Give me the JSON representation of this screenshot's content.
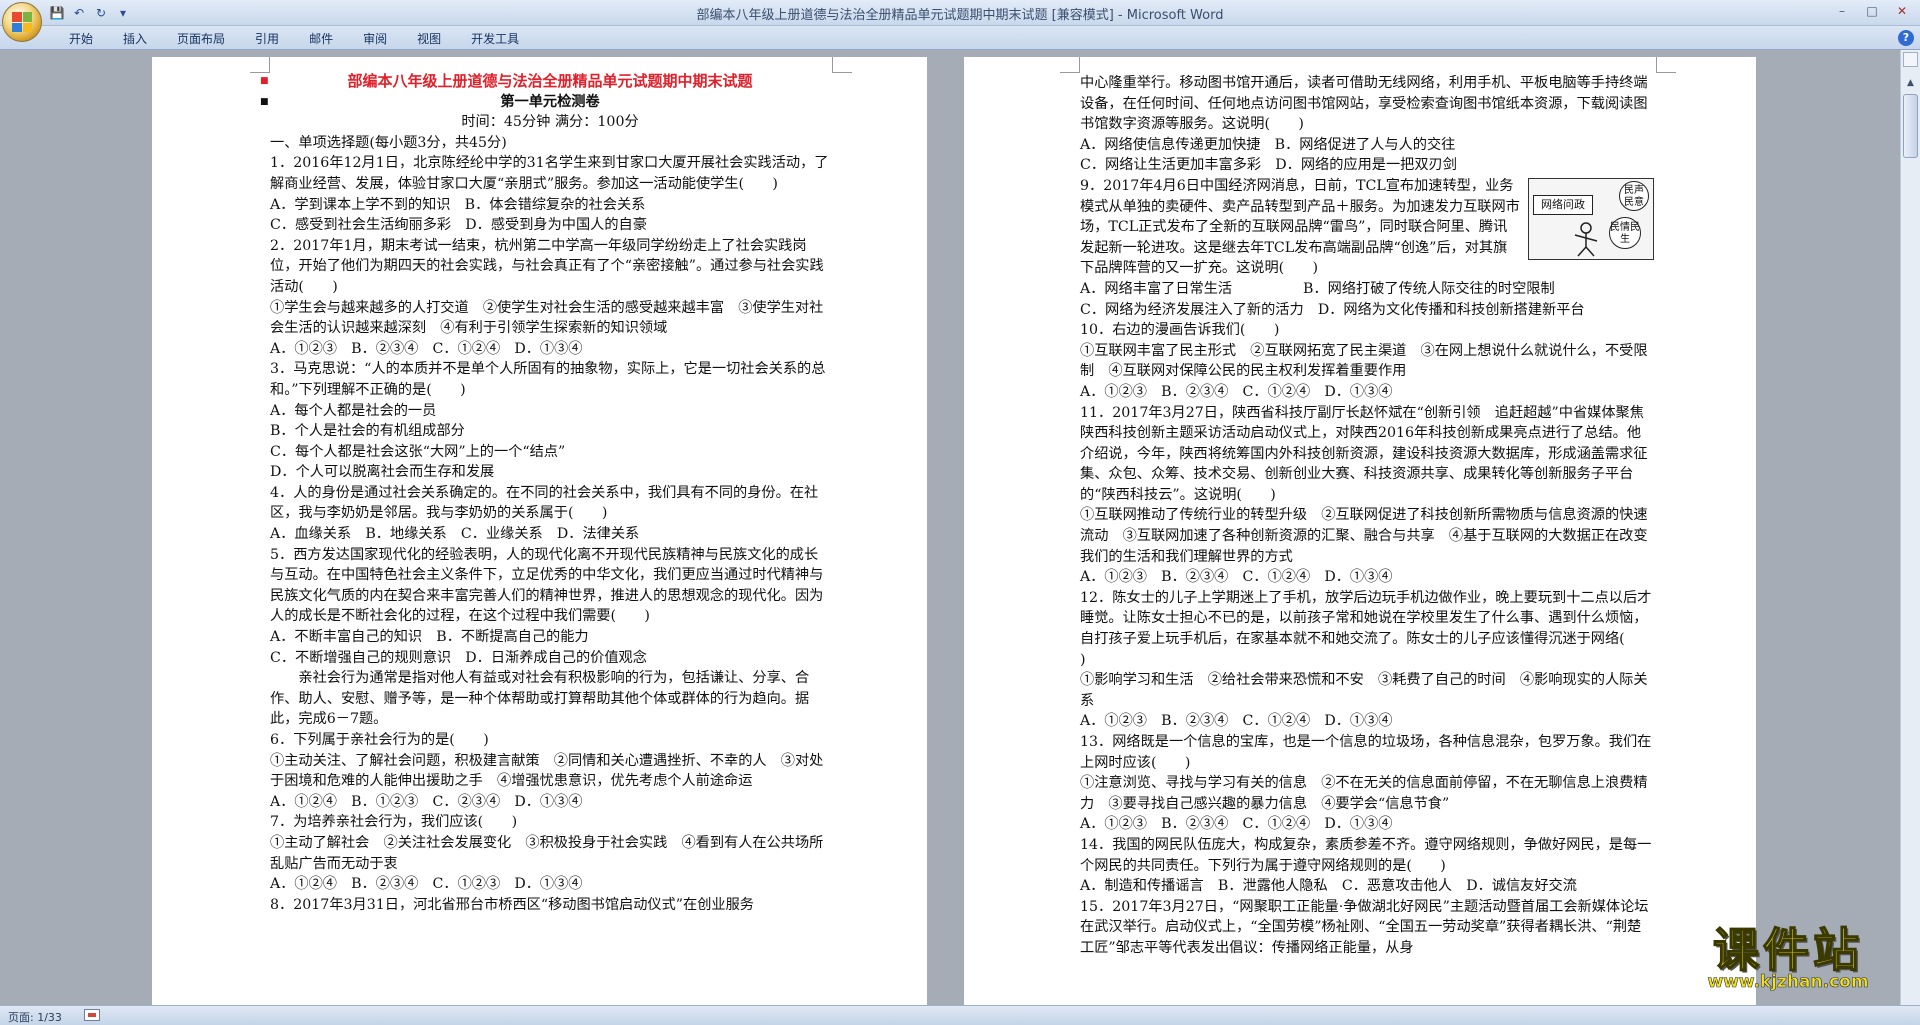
{
  "window": {
    "title": "部编本八年级上册道德与法治全册精品单元试题期中期末试题 [兼容模式] - Microsoft Word"
  },
  "ribbon": {
    "tabs": [
      "开始",
      "插入",
      "页面布局",
      "引用",
      "邮件",
      "审阅",
      "视图",
      "开发工具"
    ]
  },
  "statusbar": {
    "page": "页面: 1/33"
  },
  "watermark": {
    "brand": "课件站",
    "url": "www.kjzhan.com"
  },
  "icons": {
    "office_button": "office-button-icon",
    "save": "save-icon",
    "undo": "undo-icon",
    "redo": "redo-icon",
    "help": "help-icon"
  },
  "colors": {
    "doc_title": "#e0202a",
    "watermark": "#f2e21a",
    "page_bg": "#a5acb5"
  },
  "left_page": {
    "doc_title": "部编本八年级上册道德与法治全册精品单元试题期中期末试题",
    "unit_title": "第一单元检测卷",
    "time_info": "时间：45分钟      满分：100分",
    "lines": [
      "一、单项选择题(每小题3分，共45分)",
      "1．2016年12月1日，北京陈经纶中学的31名学生来到甘家口大厦开展社会实践活动，了解商业经营、发展，体验甘家口大厦“亲朋式”服务。参加这一活动能使学生(　　)",
      "A．学到课本上学不到的知识　B．体会错综复杂的社会关系",
      "C．感受到社会生活绚丽多彩　D．感受到身为中国人的自豪",
      "2．2017年1月，期末考试一结束，杭州第二中学高一年级同学纷纷走上了社会实践岗位，开始了他们为期四天的社会实践，与社会真正有了个“亲密接触”。通过参与社会实践活动(　　)",
      "①学生会与越来越多的人打交道　②使学生对社会生活的感受越来越丰富　③使学生对社会生活的认识越来越深刻　④有利于引领学生探索新的知识领域",
      "A．①②③　B．②③④　C．①②④　D．①③④",
      "3．马克思说：“人的本质并不是单个人所固有的抽象物，实际上，它是一切社会关系的总和。”下列理解不正确的是(　　)",
      "A．每个人都是社会的一员",
      "B．个人是社会的有机组成部分",
      "C．每个人都是社会这张“大网”上的一个“结点”",
      "D．个人可以脱离社会而生存和发展",
      "4．人的身份是通过社会关系确定的。在不同的社会关系中，我们具有不同的身份。在社区，我与李奶奶是邻居。我与李奶奶的关系属于(　　)",
      "A．血缘关系　B．地缘关系　C．业缘关系　D．法律关系",
      "5．西方发达国家现代化的经验表明，人的现代化离不开现代民族精神与民族文化的成长与互动。在中国特色社会主义条件下，立足优秀的中华文化，我们更应当通过时代精神与民族文化气质的内在契合来丰富完善人们的精神世界，推进人的思想观念的现代化。因为人的成长是不断社会化的过程，在这个过程中我们需要(　　)",
      "A．不断丰富自己的知识　B．不断提高自己的能力",
      "C．不断增强自己的规则意识　D．日渐养成自己的价值观念",
      "亲社会行为通常是指对他人有益或对社会有积极影响的行为，包括谦让、分享、合作、助人、安慰、赠予等，是一种个体帮助或打算帮助其他个体或群体的行为趋向。据此，完成6－7题。",
      "6．下列属于亲社会行为的是(　　)",
      "①主动关注、了解社会问题，积极建言献策　②同情和关心遭遇挫折、不幸的人　③对处于困境和危难的人能伸出援助之手　④增强忧患意识，优先考虑个人前途命运",
      "A．①②④　B．①②③　C．②③④　D．①③④",
      "7．为培养亲社会行为，我们应该(　　)",
      "①主动了解社会　②关注社会发展变化　③积极投身于社会实践　④看到有人在公共场所乱贴广告而无动于衷",
      "A．①②④　B．②③④　C．①②③　D．①③④",
      "8．2017年3月31日，河北省邢台市桥西区“移动图书馆启动仪式”在创业服务"
    ]
  },
  "right_page": {
    "lines_top": [
      "中心隆重举行。移动图书馆开通后，读者可借助无线网络，利用手机、平板电脑等手持终端设备，在任何时间、任何地点访问图书馆网站，享受检索查询图书馆纸本资源，下载阅读图书馆数字资源等服务。这说明(　　)",
      "A．网络使信息传递更加快捷　B．网络促进了人与人的交往",
      "C．网络让生活更加丰富多彩　D．网络的应用是一把双刃剑"
    ],
    "q9": "9．2017年4月6日中国经济网消息，日前，TCL宣布加速转型，业务模式从单独的卖硬件、卖产品转型到产品＋服务。为加速发力互联网市场，TCL正式发布了全新的互联网品牌“雷鸟”，同时联合阿里、腾讯发起新一轮进攻。这是继去年TCL发布高端副品牌“创逸”后，对其旗下品牌阵营的又一扩充。这说明(　　)",
    "q9_a": "A．网络丰富了日常生活　　　　　B．网络打破了传统人际交往的时空限制",
    "cartoon": {
      "sign": "网络问政",
      "bubble1": "民声民意",
      "bubble2": "民情民生"
    },
    "lines_bottom": [
      "C．网络为经济发展注入了新的活力　D．网络为文化传播和科技创新搭建新平台",
      "10．右边的漫画告诉我们(　　)",
      "①互联网丰富了民主形式　②互联网拓宽了民主渠道　③在网上想说什么就说什么，不受限制　④互联网对保障公民的民主权利发挥着重要作用",
      "A．①②③　B．②③④　C．①②④　D．①③④",
      "11．2017年3月27日，陕西省科技厅副厅长赵怀斌在“创新引领　追赶超越”中省媒体聚焦陕西科技创新主题采访活动启动仪式上，对陕西2016年科技创新成果亮点进行了总结。他介绍说，今年，陕西将统筹国内外科技创新资源，建设科技资源大数据库，形成涵盖需求征集、众包、众筹、技术交易、创新创业大赛、科技资源共享、成果转化等创新服务子平台的“陕西科技云”。这说明(　　)",
      "①互联网推动了传统行业的转型升级　②互联网促进了科技创新所需物质与信息资源的快速流动　③互联网加速了各种创新资源的汇聚、融合与共享　④基于互联网的大数据正在改变我们的生活和我们理解世界的方式",
      "A．①②③　B．②③④　C．①②④　D．①③④",
      "12．陈女士的儿子上学期迷上了手机，放学后边玩手机边做作业，晚上要玩到十二点以后才睡觉。让陈女士担心不已的是，以前孩子常和她说在学校里发生了什么事、遇到什么烦恼，自打孩子爱上玩手机后，在家基本就不和她交流了。陈女士的儿子应该懂得沉迷于网络(　　)",
      "①影响学习和生活　②给社会带来恐慌和不安　③耗费了自己的时间　④影响现实的人际关系",
      "A．①②③　B．②③④　C．①②④　D．①③④",
      "13．网络既是一个信息的宝库，也是一个信息的垃圾场，各种信息混杂，包罗万象。我们在上网时应该(　　)",
      "①注意浏览、寻找与学习有关的信息　②不在无关的信息面前停留，不在无聊信息上浪费精力　③要寻找自己感兴趣的暴力信息　④要学会“信息节食”",
      "A．①②③　B．②③④　C．①②④　D．①③④",
      "14．我国的网民队伍庞大，构成复杂，素质参差不齐。遵守网络规则，争做好网民，是每一个网民的共同责任。下列行为属于遵守网络规则的是(　　)",
      "A．制造和传播谣言　B．泄露他人隐私　C．恶意攻击他人　D．诚信友好交流",
      "15．2017年3月27日，“网聚职工正能量·争做湖北好网民”主题活动暨首届工会新媒体论坛在武汉举行。启动仪式上，“全国劳模”杨祉刚、“全国五一劳动奖章”获得者耦长洪、“荆楚工匠”邹志平等代表发出倡议：传播网络正能量，从身"
    ]
  }
}
